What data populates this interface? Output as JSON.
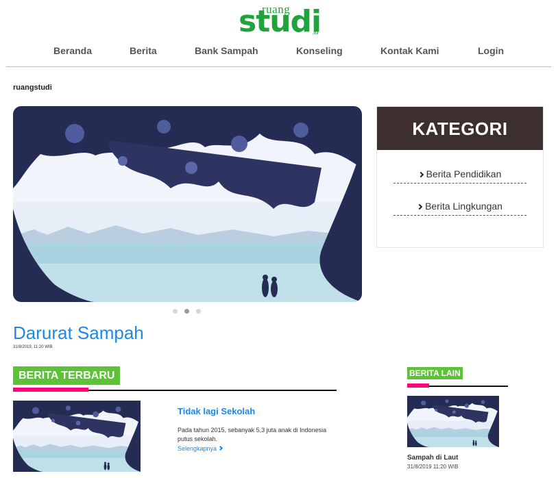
{
  "logo": {
    "top": "ruang",
    "main": "studi",
    "suffix": ".id"
  },
  "nav": {
    "items": [
      {
        "label": "Beranda"
      },
      {
        "label": "Berita"
      },
      {
        "label": "Bank Sampah"
      },
      {
        "label": "Konseling"
      },
      {
        "label": "Kontak Kami"
      },
      {
        "label": "Login"
      }
    ]
  },
  "site_label": "ruangstudi",
  "carousel": {
    "slide_count": 3,
    "active_index": 1,
    "image": "lake-tree-silhouette-couple-image"
  },
  "kategori": {
    "title": "KATEGORI",
    "items": [
      {
        "label": "Berita Pendidikan",
        "icon": "chevron-right-icon"
      },
      {
        "label": "Berita Lingkungan",
        "icon": "chevron-right-icon"
      }
    ]
  },
  "headline": {
    "title": "Darurat Sampah",
    "date": "31/8/2019, 11:20 WIB"
  },
  "berita_terbaru": {
    "heading": "BERITA TERBARU",
    "articles": [
      {
        "title": "Tidak lagi Sekolah",
        "excerpt": "Pada tahun 2015, sebanyak 5,3 juta anak di Indonesia putus sekolah.",
        "more": "Selengkapnya"
      }
    ]
  },
  "berita_lain": {
    "heading": "BERITA LAIN",
    "items": [
      {
        "title": "Sampah di Laut",
        "date": "31/8/2019 11:20 WIB"
      }
    ]
  },
  "colors": {
    "brand_green": "#1fa33a",
    "badge_green": "#5cc236",
    "accent_pink": "#ff007f",
    "link_blue": "#1e88e5",
    "kategori_header": "#3c2f2d"
  }
}
